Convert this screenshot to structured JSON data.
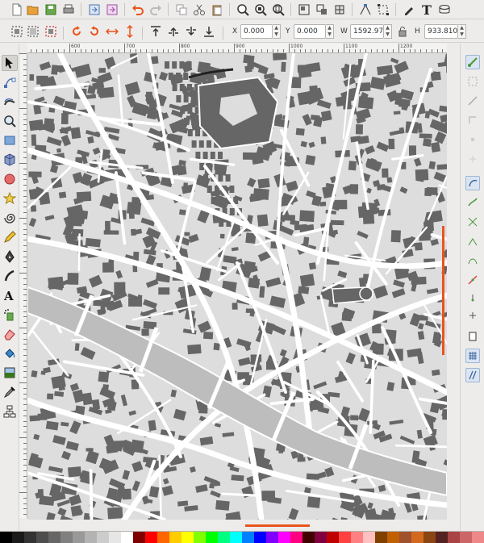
{
  "controls": {
    "x_label": "X",
    "x_value": "0.000",
    "y_label": "Y",
    "y_value": "0.000",
    "w_label": "W",
    "w_value": "1592.97",
    "h_label": "H",
    "h_value": "933.810"
  },
  "ruler": {
    "labels": [
      "600",
      "700",
      "800",
      "900",
      "1000",
      "1100",
      "1200"
    ]
  },
  "colors": {
    "accent": "#e9541d",
    "building": "#666666",
    "block": "#dddddd",
    "street": "#ffffff",
    "river": "#bdbdbd"
  },
  "palette": [
    "#000000",
    "#1a1a1a",
    "#333333",
    "#4d4d4d",
    "#666666",
    "#808080",
    "#999999",
    "#b3b3b3",
    "#cccccc",
    "#e6e6e6",
    "#ffffff",
    "#800000",
    "#ff0000",
    "#ff6600",
    "#ffcc00",
    "#ffff00",
    "#80ff00",
    "#00ff00",
    "#00ff80",
    "#00ffff",
    "#0080ff",
    "#0000ff",
    "#8000ff",
    "#ff00ff",
    "#ff0080",
    "#400000",
    "#800040",
    "#c00000",
    "#ff4040",
    "#ff8080",
    "#ffc0c0",
    "#804000",
    "#c06000",
    "#a0522d",
    "#d2691e",
    "#8b4513",
    "#552222",
    "#aa4444",
    "#cc6666",
    "#ee8888"
  ]
}
